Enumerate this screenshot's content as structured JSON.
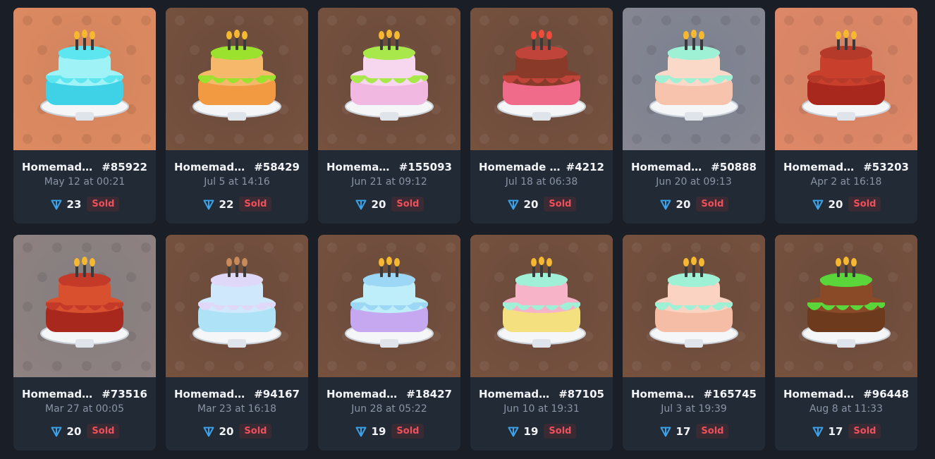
{
  "colors": {
    "page_bg": "#1a1e26",
    "card_bg": "#222a36",
    "sold": "#f0505c",
    "ton": "#3aa3ea"
  },
  "items": [
    {
      "name": "Homemade Cake",
      "number": "#85922",
      "date": "May 12 at 00:21",
      "price": "23",
      "status": "Sold",
      "bg": "#dd8a60",
      "dark": false,
      "top": "#5ee6f0",
      "mid": "#9ff3f7",
      "bot": "#3fd2e6",
      "flame": "#f5b82e"
    },
    {
      "name": "Homemade Cake",
      "number": "#58429",
      "date": "Jul 5 at 14:16",
      "price": "22",
      "status": "Sold",
      "bg": "#232323",
      "dark": true,
      "top": "#9be22e",
      "mid": "#f6b86a",
      "bot": "#f29a42",
      "flame": "#f5b82e"
    },
    {
      "name": "Homemade Cake",
      "number": "#155093",
      "date": "Jun 21 at 09:12",
      "price": "20",
      "status": "Sold",
      "bg": "#232323",
      "dark": true,
      "top": "#a8e84a",
      "mid": "#f7d7ef",
      "bot": "#f1b9e2",
      "flame": "#f5b82e"
    },
    {
      "name": "Homemade Cake",
      "number": "#4212",
      "date": "Jul 18 at 06:38",
      "price": "20",
      "status": "Sold",
      "bg": "#232323",
      "dark": true,
      "top": "#c0443a",
      "mid": "#8a3a28",
      "bot": "#f06a8a",
      "flame": "#f24a3a"
    },
    {
      "name": "Homemade Cake",
      "number": "#50888",
      "date": "Jun 20 at 09:13",
      "price": "20",
      "status": "Sold",
      "bg": "#4d86b4",
      "dark": false,
      "top": "#9ff1d6",
      "mid": "#fbd9c9",
      "bot": "#f7c3ad",
      "flame": "#f5b82e"
    },
    {
      "name": "Homemade Cake",
      "number": "#53203",
      "date": "Apr 2 at 16:18",
      "price": "20",
      "status": "Sold",
      "bg": "#e0876c",
      "dark": false,
      "top": "#b53a2a",
      "mid": "#c8402c",
      "bot": "#a8281e",
      "flame": "#f5b82e"
    },
    {
      "name": "Homemade Cake",
      "number": "#73516",
      "date": "Mar 27 at 00:05",
      "price": "20",
      "status": "Sold",
      "bg": "#5c7f98",
      "dark": false,
      "top": "#c43a28",
      "mid": "#d8502e",
      "bot": "#a8281e",
      "flame": "#f5b82e"
    },
    {
      "name": "Homemade Cake",
      "number": "#94167",
      "date": "Mar 23 at 16:18",
      "price": "20",
      "status": "Sold",
      "bg": "#232323",
      "dark": true,
      "top": "#e0d8f8",
      "mid": "#cfe8fb",
      "bot": "#aee3f7",
      "flame": "#c88a5a"
    },
    {
      "name": "Homemade Cake",
      "number": "#18427",
      "date": "Jun 28 at 05:22",
      "price": "19",
      "status": "Sold",
      "bg": "#232323",
      "dark": true,
      "top": "#9cd8f5",
      "mid": "#bfeefb",
      "bot": "#c5a8ef",
      "flame": "#f5b82e"
    },
    {
      "name": "Homemade Cake",
      "number": "#87105",
      "date": "Jun 10 at 19:31",
      "price": "19",
      "status": "Sold",
      "bg": "#232323",
      "dark": true,
      "top": "#a0f0d8",
      "mid": "#f7b4c8",
      "bot": "#f5e080",
      "flame": "#f5b82e"
    },
    {
      "name": "Homemade Cake",
      "number": "#165745",
      "date": "Jul 3 at 19:39",
      "price": "17",
      "status": "Sold",
      "bg": "#232323",
      "dark": true,
      "top": "#9ff1d6",
      "mid": "#fbd3c3",
      "bot": "#f5bca6",
      "flame": "#f5b82e"
    },
    {
      "name": "Homemade Cake",
      "number": "#96448",
      "date": "Aug 8 at 11:33",
      "price": "17",
      "status": "Sold",
      "bg": "#232323",
      "dark": true,
      "top": "#5ad63a",
      "mid": "#8a4a28",
      "bot": "#6e3a1e",
      "flame": "#f5b82e"
    }
  ]
}
